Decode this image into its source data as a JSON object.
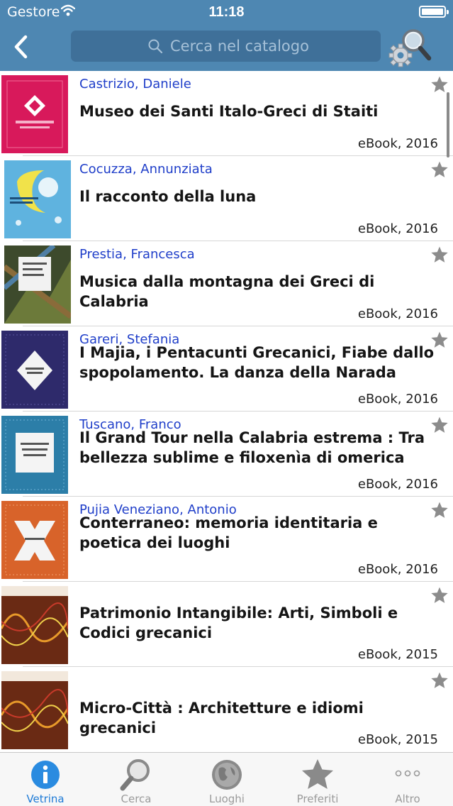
{
  "status_bar": {
    "carrier": "Gestore",
    "time": "11:18"
  },
  "header": {
    "search": {
      "placeholder": "Cerca nel catalogo",
      "value": ""
    }
  },
  "items": [
    {
      "author": "Castrizio, Daniele",
      "title": "Museo dei Santi Italo-Greci di Staiti",
      "meta": "eBook, 2016"
    },
    {
      "author": "Cocuzza, Annunziata",
      "title": "Il racconto della luna",
      "meta": "eBook, 2016"
    },
    {
      "author": "Prestia, Francesca",
      "title": "Musica dalla montagna dei Greci di Calabria",
      "meta": "eBook, 2016"
    },
    {
      "author": "Gareri, Stefania",
      "title": "I Majia, i Pentacunti Grecanici, Fiabe dallo spopolamento. La danza della Narada",
      "meta": "eBook, 2016"
    },
    {
      "author": "Tuscano, Franco",
      "title": "Il Grand Tour nella Calabria estrema : Tra bellezza sublime e filoxenìa di omerica",
      "meta": "eBook, 2016"
    },
    {
      "author": "Pujia Veneziano, Antonio",
      "title": "Conterraneo: memoria identitaria e poetica dei luoghi",
      "meta": "eBook, 2016"
    },
    {
      "author": "",
      "title": "Patrimonio Intangibile: Arti, Simboli e Codici grecanici",
      "meta": "eBook, 2015"
    },
    {
      "author": "",
      "title": "Micro-Città : Architetture e idiomi grecanici",
      "meta": "eBook, 2015"
    }
  ],
  "tabs": [
    {
      "label": "Vetrina",
      "icon": "info-icon",
      "active": true
    },
    {
      "label": "Cerca",
      "icon": "magnifier-icon",
      "active": false
    },
    {
      "label": "Luoghi",
      "icon": "globe-icon",
      "active": false
    },
    {
      "label": "Preferiti",
      "icon": "star-icon",
      "active": false
    },
    {
      "label": "Altro",
      "icon": "more-icon",
      "active": false
    }
  ],
  "colors": {
    "header": "#4e87b2",
    "author": "#1f3ec9",
    "tab_active": "#1d7ad6",
    "tab_inactive": "#9a9a9a"
  }
}
